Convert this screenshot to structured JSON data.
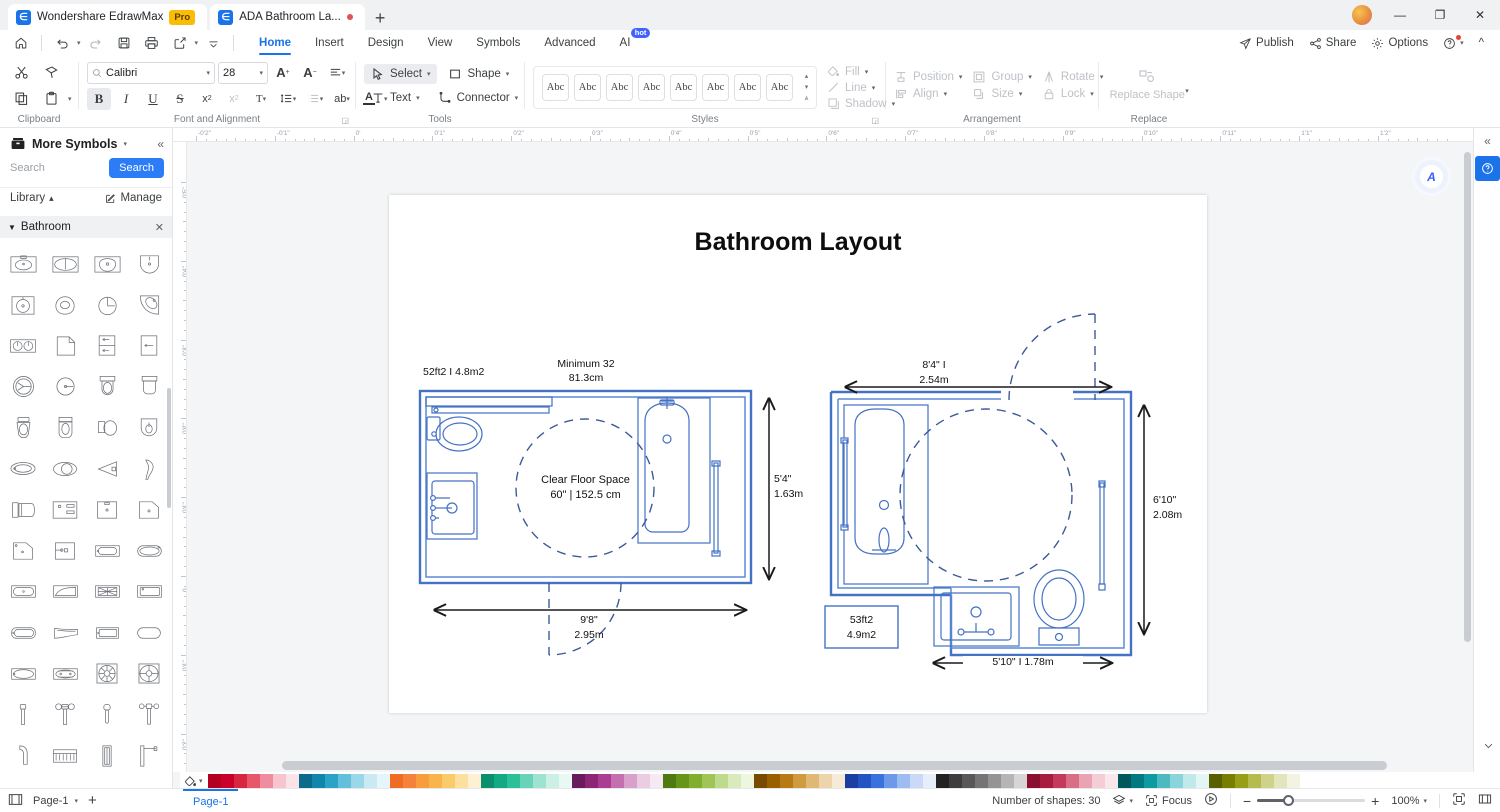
{
  "window": {
    "app_tab_title": "Wondershare EdrawMax",
    "pro_badge": "Pro",
    "doc_tab_title": "ADA Bathroom La...",
    "new_tab_label": "+",
    "minimize": "—",
    "maximize": "❐",
    "close": "✕"
  },
  "quick_access": {
    "home": "home-icon",
    "undo": "undo-icon",
    "redo": "redo-icon",
    "save": "save-icon",
    "print": "print-icon",
    "export": "export-icon",
    "more": "more-icon"
  },
  "menubar": {
    "items": [
      {
        "label": "Home",
        "active": true
      },
      {
        "label": "Insert",
        "active": false
      },
      {
        "label": "Design",
        "active": false
      },
      {
        "label": "View",
        "active": false
      },
      {
        "label": "Symbols",
        "active": false
      },
      {
        "label": "Advanced",
        "active": false
      },
      {
        "label": "AI",
        "active": false,
        "badge": "hot"
      }
    ],
    "right": [
      {
        "label": "Publish",
        "icon": "publish-icon"
      },
      {
        "label": "Share",
        "icon": "share-icon"
      },
      {
        "label": "Options",
        "icon": "gear-icon"
      }
    ],
    "help": "?",
    "collapse": "^"
  },
  "ribbon": {
    "clipboard": {
      "group_label": "Clipboard",
      "cut": "Cut",
      "format_painter": "Format Painter",
      "copy": "Copy",
      "paste": "Paste"
    },
    "font": {
      "group_label": "Font and Alignment",
      "font_family": "Calibri",
      "font_size": "28",
      "grow_font": "A+",
      "shrink_font": "A-",
      "align": "align-icon",
      "bold": "B",
      "italic": "I",
      "underline": "U",
      "strikethrough": "S",
      "superscript": "x²",
      "subscript": "x₂",
      "text_direction": "T",
      "line_spacing": "line-spacing-icon",
      "list": "list-icon",
      "text_case": "ab",
      "font_color": "A"
    },
    "tools": {
      "group_label": "Tools",
      "select": "Select",
      "shape": "Shape",
      "text": "Text",
      "connector": "Connector"
    },
    "styles": {
      "group_label": "Styles",
      "swatches": [
        "Abc",
        "Abc",
        "Abc",
        "Abc",
        "Abc",
        "Abc",
        "Abc",
        "Abc"
      ],
      "fill": "Fill",
      "line": "Line",
      "shadow": "Shadow"
    },
    "arrangement": {
      "group_label": "Arrangement",
      "position": "Position",
      "group": "Group",
      "rotate": "Rotate",
      "align": "Align",
      "size": "Size",
      "lock": "Lock"
    },
    "replace": {
      "group_label": "Replace",
      "replace_shape": "Replace Shape"
    }
  },
  "left_panel": {
    "title": "More Symbols",
    "collapse_icon": "chevrons-left-icon",
    "search_placeholder": "Search",
    "search_button": "Search",
    "library_label": "Library",
    "manage_label": "Manage",
    "category": "Bathroom",
    "category_close": "✕"
  },
  "rulers": {
    "horizontal": [
      "-0'2\"",
      "-0'1\"",
      "0'",
      "0'1\"",
      "0'2\"",
      "0'3\"",
      "0'4\"",
      "0'5\"",
      "0'6\"",
      "0'7\"",
      "0'8\"",
      "0'9\"",
      "0'10\"",
      "0'11\"",
      "1'1\"",
      "1'2\""
    ],
    "vertical": [
      "0'5\"",
      "0'4\"",
      "0'3\"",
      "0'2\"",
      "0'1\"",
      "0",
      "0'1\"",
      "0'2\"",
      "0'3\""
    ]
  },
  "canvas": {
    "document_title": "Bathroom Layout",
    "left_plan": {
      "area_label": "52ft2 I 4.8m2",
      "door_min_label": "Minimum 32\n81.3cm",
      "door_min_line1": "Minimum 32",
      "door_min_line2": "81.3cm",
      "clear_space_line1": "Clear Floor Space",
      "clear_space_line2": "60\" | 152.5 cm",
      "height_line1": "5'4\"",
      "height_line2": "1.63m",
      "width_line1": "9'8\"",
      "width_line2": "2.95m"
    },
    "right_plan": {
      "area_line1": "53ft2",
      "area_line2": "4.9m2",
      "top_line1": "8'4\" I",
      "top_line2": "2.54m",
      "right_line1": "6'10\"",
      "right_line2": "2.08m",
      "bottom_label": "5'10\" I 1.78m"
    }
  },
  "ai_assistant": {
    "label": "ai-orb"
  },
  "right_rail": {
    "collapse": "chevrons-right-icon",
    "help": "?"
  },
  "palette": {
    "fill_label": "fill-bucket-icon",
    "colors": [
      "#b30020",
      "#c9002a",
      "#d82640",
      "#e8566b",
      "#f08ca0",
      "#f8c4ce",
      "#fbe3e8",
      "#0c6b8a",
      "#1185ab",
      "#2ba3c7",
      "#62c0da",
      "#9ad7e9",
      "#c9eaf3",
      "#e6f5fa",
      "#ef6c23",
      "#f5823a",
      "#f79d3c",
      "#f9b44c",
      "#fbcb6a",
      "#fde0a0",
      "#fef0d2",
      "#0a8f6e",
      "#13a982",
      "#2cc099",
      "#68d3b8",
      "#9ee2d0",
      "#cdf0e6",
      "#e8f8f3",
      "#6a1b5e",
      "#8c2675",
      "#ab3e92",
      "#c46fb0",
      "#daa0cc",
      "#eccce3",
      "#f7e9f3",
      "#4f7a10",
      "#66951a",
      "#81ae2c",
      "#a0c557",
      "#bedb8d",
      "#d9ebbd",
      "#eef6e0",
      "#7a4a00",
      "#996000",
      "#b87a15",
      "#cf9a40",
      "#e0b875",
      "#eed4ab",
      "#f7ead6",
      "#1a3fa0",
      "#2454c2",
      "#3a72dd",
      "#6e99e9",
      "#9dbcf1",
      "#c9d9f7",
      "#e6eefc",
      "#222222",
      "#3d3d3d",
      "#585858",
      "#757575",
      "#949494",
      "#b5b5b5",
      "#d6d6d6",
      "#8a0f2e",
      "#a81c3f",
      "#c43a5a",
      "#d96f87",
      "#e9a3b3",
      "#f4cdd6",
      "#fae7ec",
      "#00575c",
      "#007a80",
      "#0f9aa1",
      "#4cbac0",
      "#8ad5d9",
      "#c0e9eb",
      "#e4f5f6",
      "#5a5f00",
      "#787e00",
      "#989e16",
      "#b5bb4c",
      "#ced389",
      "#e3e6bd",
      "#f2f3e0"
    ]
  },
  "statusbar": {
    "page_selector": "Page-1",
    "add_page": "+",
    "page_tab": "Page-1",
    "shapes_count": "Number of shapes: 30",
    "layers_icon": "layers-icon",
    "focus_label": "Focus",
    "present_icon": "present-icon",
    "zoom_out": "−",
    "zoom_in": "+",
    "zoom_level": "100%",
    "fit_page": "fit-page-icon",
    "fit_width": "fit-width-icon"
  }
}
